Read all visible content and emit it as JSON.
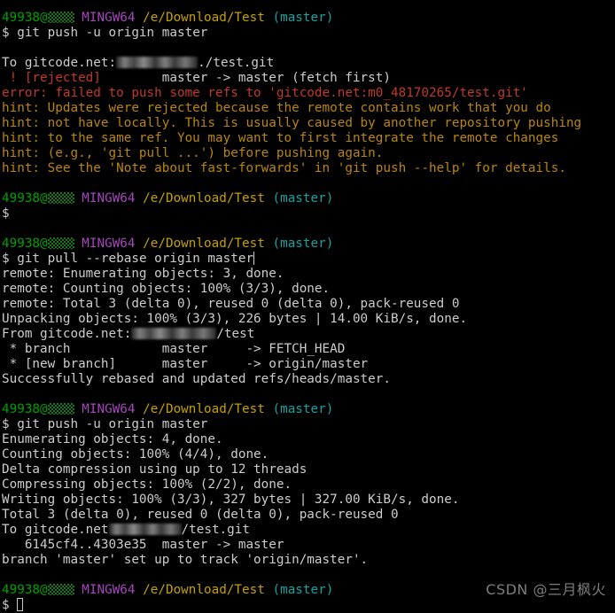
{
  "terminal": {
    "shell": "MINGW64",
    "user": "49938@",
    "host_redacted": "mosaic-redaction",
    "path": "/e/Download/Test",
    "branch": "(master)",
    "prompt_symbol": "$",
    "colors": {
      "background": "#000000",
      "foreground": "#cccccc",
      "user": "#00a000",
      "shell": "#a347ba",
      "path": "#c4a000",
      "branch": "#17a2a2",
      "error": "#c0392b",
      "hint": "#b8860b",
      "watermark": "#7d7d7d"
    },
    "blocks": [
      {
        "id": "block-1-push-rejected",
        "prompt": true,
        "command": " git push -u origin master",
        "lines": [
          {
            "id": "l1",
            "kind": "blank",
            "text": ""
          },
          {
            "id": "l2",
            "kind": "plain",
            "text": "To gitcode.net:",
            "suffix": "/test.git",
            "redacted": true
          },
          {
            "id": "l3",
            "kind": "rejected",
            "tag": " ! [rejected]",
            "rest": "        master -> master (fetch first)"
          },
          {
            "id": "l4",
            "kind": "error",
            "text": "error: failed to push some refs to 'gitcode.net:m0_48170265/test.git'"
          },
          {
            "id": "l5",
            "kind": "hint",
            "text": "hint: Updates were rejected because the remote contains work that you do"
          },
          {
            "id": "l6",
            "kind": "hint",
            "text": "hint: not have locally. This is usually caused by another repository pushing"
          },
          {
            "id": "l7",
            "kind": "hint",
            "text": "hint: to the same ref. You may want to first integrate the remote changes"
          },
          {
            "id": "l8",
            "kind": "hint",
            "text": "hint: (e.g., 'git pull ...') before pushing again."
          },
          {
            "id": "l9",
            "kind": "hint",
            "text": "hint: See the 'Note about fast-forwards' in 'git push --help' for details."
          }
        ]
      },
      {
        "id": "block-2-empty-prompt",
        "prompt": true,
        "command": "",
        "lines": []
      },
      {
        "id": "block-3-pull-rebase",
        "prompt": true,
        "command": "git pull --rebase origin master",
        "lines": [
          {
            "id": "m1",
            "kind": "plain",
            "text": "remote: Enumerating objects: 3, done."
          },
          {
            "id": "m2",
            "kind": "plain",
            "text": "remote: Counting objects: 100% (3/3), done."
          },
          {
            "id": "m3",
            "kind": "plain",
            "text": "remote: Total 3 (delta 0), reused 0 (delta 0), pack-reused 0"
          },
          {
            "id": "m4",
            "kind": "plain",
            "text": "Unpacking objects: 100% (3/3), 226 bytes | 14.00 KiB/s, done."
          },
          {
            "id": "m5",
            "kind": "plain",
            "text": "From gitcode.net:",
            "suffix": "/test",
            "redacted": true
          },
          {
            "id": "m6",
            "kind": "plain",
            "text": " * branch            master     -> FETCH_HEAD"
          },
          {
            "id": "m7",
            "kind": "plain",
            "text": " * [new branch]      master     -> origin/master"
          },
          {
            "id": "m8",
            "kind": "plain",
            "text": "Successfully rebased and updated refs/heads/master."
          }
        ]
      },
      {
        "id": "block-4-push-success",
        "prompt": true,
        "command": " git push -u origin master",
        "lines": [
          {
            "id": "n1",
            "kind": "plain",
            "text": "Enumerating objects: 4, done."
          },
          {
            "id": "n2",
            "kind": "plain",
            "text": "Counting objects: 100% (4/4), done."
          },
          {
            "id": "n3",
            "kind": "plain",
            "text": "Delta compression using up to 12 threads"
          },
          {
            "id": "n4",
            "kind": "plain",
            "text": "Compressing objects: 100% (2/2), done."
          },
          {
            "id": "n5",
            "kind": "plain",
            "text": "Writing objects: 100% (3/3), 327 bytes | 327.00 KiB/s, done."
          },
          {
            "id": "n6",
            "kind": "plain",
            "text": "Total 3 (delta 0), reused 0 (delta 0), pack-reused 0"
          },
          {
            "id": "n7",
            "kind": "plain",
            "text": "To gitcode.net",
            "suffix": "/test.git",
            "redacted": true
          },
          {
            "id": "n8",
            "kind": "plain",
            "text": "   6145cf4..4303e35  master -> master"
          },
          {
            "id": "n9",
            "kind": "plain",
            "text": "branch 'master' set up to track 'origin/master'."
          }
        ]
      },
      {
        "id": "block-5-final-prompt",
        "prompt": true,
        "command": "",
        "lines": []
      }
    ],
    "text": {
      "b1_cmd": " git push -u origin master",
      "b1_to_prefix": "To gitcode.net:",
      "b1_to_suffix": "./test.git",
      "b1_rejected_tag": " ! [rejected]",
      "b1_rejected_rest": "        master -> master (fetch first)",
      "b1_error": "error: failed to push some refs to 'gitcode.net:m0_48170265/test.git'",
      "b1_hint1": "hint: Updates were rejected because the remote contains work that you do",
      "b1_hint2": "hint: not have locally. This is usually caused by another repository pushing",
      "b1_hint3": "hint: to the same ref. You may want to first integrate the remote changes",
      "b1_hint4": "hint: (e.g., 'git pull ...') before pushing again.",
      "b1_hint5": "hint: See the 'Note about fast-forwards' in 'git push --help' for details.",
      "b3_cmd": "git pull --rebase origin master",
      "b3_l1": "remote: Enumerating objects: 3, done.",
      "b3_l2": "remote: Counting objects: 100% (3/3), done.",
      "b3_l3": "remote: Total 3 (delta 0), reused 0 (delta 0), pack-reused 0",
      "b3_l4": "Unpacking objects: 100% (3/3), 226 bytes | 14.00 KiB/s, done.",
      "b3_from_prefix": "From gitcode.net:",
      "b3_from_suffix": "/test",
      "b3_l6": " * branch            master     -> FETCH_HEAD",
      "b3_l7": " * [new branch]      master     -> origin/master",
      "b3_l8": "Successfully rebased and updated refs/heads/master.",
      "b4_cmd": " git push -u origin master",
      "b4_l1": "Enumerating objects: 4, done.",
      "b4_l2": "Counting objects: 100% (4/4), done.",
      "b4_l3": "Delta compression using up to 12 threads",
      "b4_l4": "Compressing objects: 100% (2/2), done.",
      "b4_l5": "Writing objects: 100% (3/3), 327 bytes | 327.00 KiB/s, done.",
      "b4_l6": "Total 3 (delta 0), reused 0 (delta 0), pack-reused 0",
      "b4_to_prefix": "To gitcode.net",
      "b4_to_suffix": "/test.git",
      "b4_l8": "   6145cf4..4303e35  master -> master",
      "b4_l9": "branch 'master' set up to track 'origin/master'."
    }
  },
  "watermark": {
    "text": "CSDN @三月枫火"
  }
}
